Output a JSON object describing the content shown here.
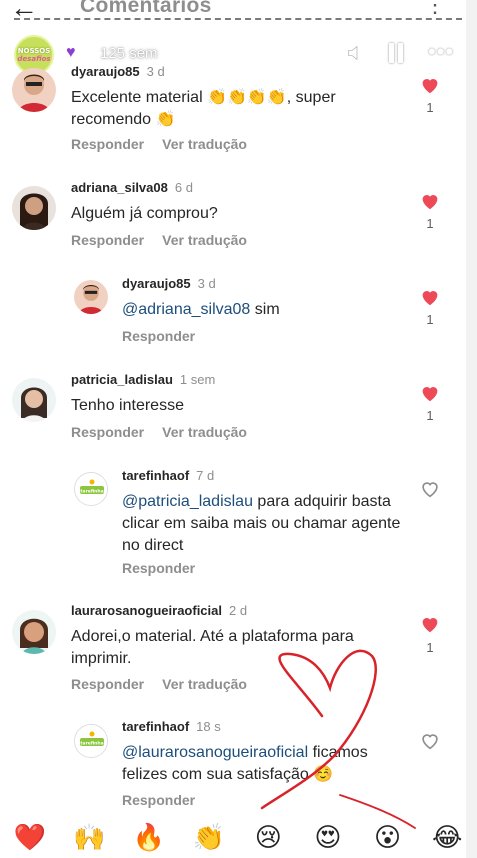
{
  "header": {
    "title": "Comentários"
  },
  "story": {
    "avatar_line1": "NOSSOS",
    "avatar_line2": "desafios",
    "time": "125 sem"
  },
  "comments": [
    {
      "username": "dyaraujo85",
      "time": "3 d",
      "text": "Excelente material 👏👏👏👏, super recomendo 👏",
      "reply": "Responder",
      "translate": "Ver tradução",
      "likes": "1"
    },
    {
      "username": "adriana_silva08",
      "time": "6 d",
      "text": "Alguém já comprou?",
      "reply": "Responder",
      "translate": "Ver tradução",
      "likes": "1"
    },
    {
      "username": "dyaraujo85",
      "time": "3 d",
      "mention": "@adriana_silva08",
      "text": " sim",
      "reply": "Responder",
      "likes": "1"
    },
    {
      "username": "patricia_ladislau",
      "time": "1 sem",
      "text": "Tenho interesse",
      "reply": "Responder",
      "translate": "Ver tradução",
      "likes": "1"
    },
    {
      "username": "tarefinhaof",
      "time": "7 d",
      "mention": "@patricia_ladislau",
      "text": " para adquirir basta clicar em saiba mais ou chamar agente no direct",
      "reply": "Responder"
    },
    {
      "username": "laurarosanogueiraoficial",
      "time": "2 d",
      "text": "Adorei,o material. Até a plataforma para imprimir.",
      "reply": "Responder",
      "translate": "Ver tradução",
      "likes": "1"
    },
    {
      "username": "tarefinhaof",
      "time": "18 s",
      "mention": "@laurarosanogueiraoficial",
      "text": " ficamos felizes com sua satisfação ☺️",
      "reply": "Responder"
    }
  ],
  "tarefinha_logo": "tarefinha",
  "emoji_bar": [
    "❤️",
    "🙌",
    "🔥",
    "👏",
    "😢",
    "😍",
    "😮",
    "😂"
  ],
  "colors": {
    "like_red": "#ed4956",
    "scribble_red": "#d8232a",
    "mention_blue": "#1d4e7c"
  }
}
